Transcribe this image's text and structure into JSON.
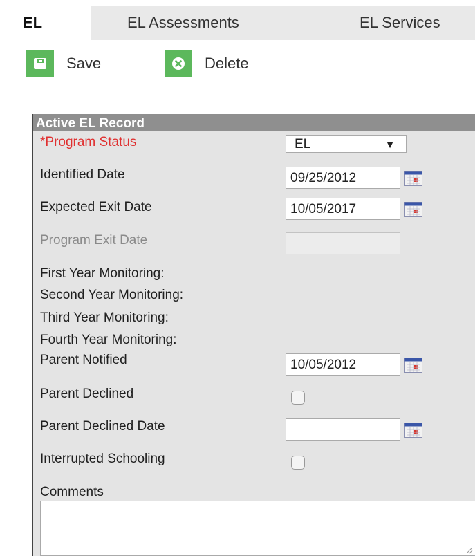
{
  "tabs": [
    {
      "label": "EL",
      "active": true
    },
    {
      "label": "EL Assessments",
      "active": false
    },
    {
      "label": "EL Services",
      "active": false
    }
  ],
  "toolbar": {
    "save_label": "Save",
    "delete_label": "Delete",
    "accent_color": "#5cb85c"
  },
  "panel": {
    "title": "Active EL Record",
    "program_status_label": "*Program Status",
    "program_status_value": "EL",
    "identified_date_label": "Identified Date",
    "identified_date_value": "09/25/2012",
    "expected_exit_label": "Expected Exit Date",
    "expected_exit_value": "10/05/2017",
    "program_exit_label": "Program Exit Date",
    "program_exit_value": "",
    "first_year_label": "First Year Monitoring:",
    "second_year_label": "Second Year Monitoring:",
    "third_year_label": "Third Year Monitoring:",
    "fourth_year_label": "Fourth Year Monitoring:",
    "parent_notified_label": "Parent Notified",
    "parent_notified_value": "10/05/2012",
    "parent_declined_label": "Parent Declined",
    "parent_declined_checked": false,
    "parent_declined_date_label": "Parent Declined Date",
    "parent_declined_date_value": "",
    "interrupted_schooling_label": "Interrupted Schooling",
    "interrupted_schooling_checked": false,
    "comments_label": "Comments",
    "comments_value": ""
  }
}
